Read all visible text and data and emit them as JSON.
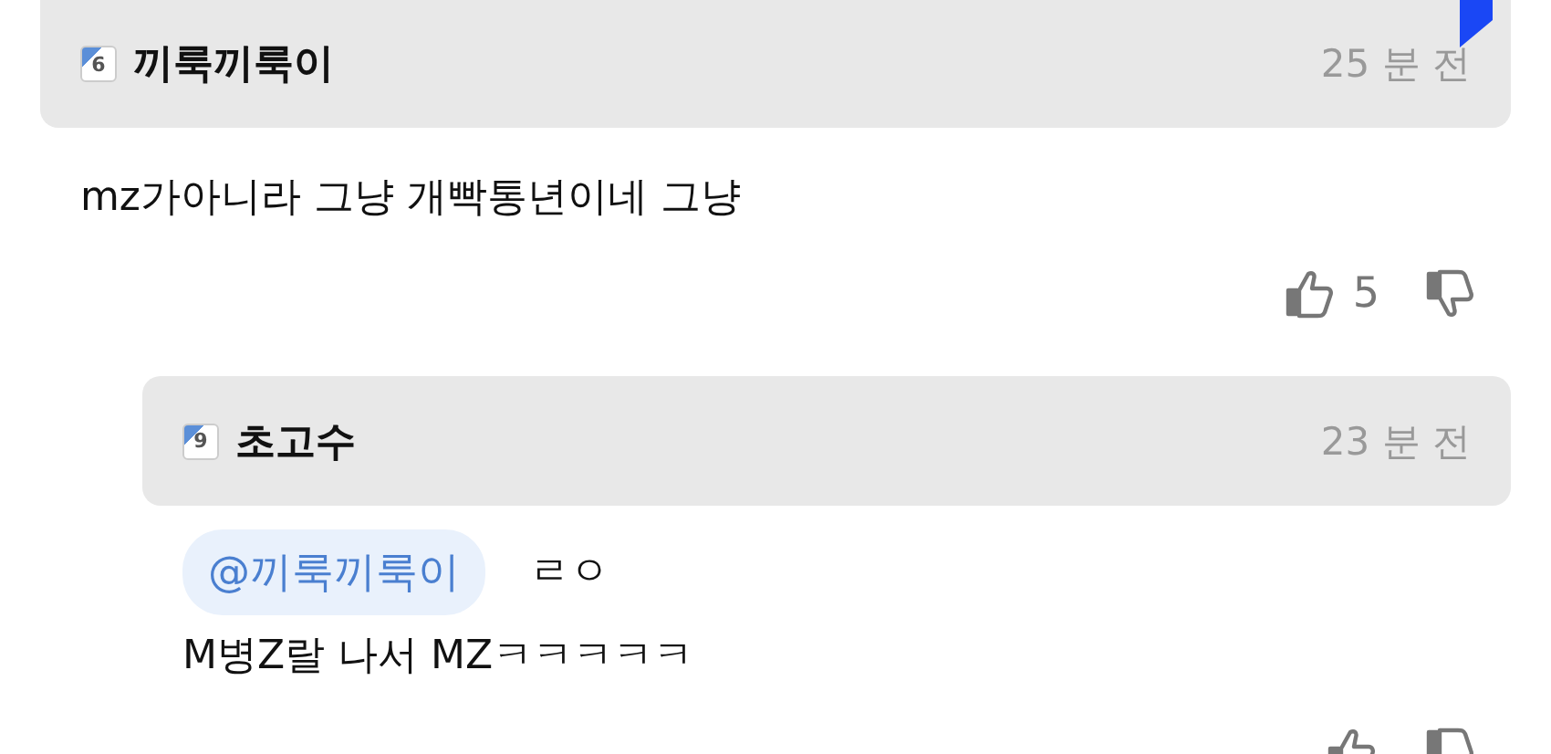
{
  "comments": [
    {
      "author": "끼룩끼룩이",
      "level": "6",
      "time": "25 분 전",
      "text": "mz가아니라 그냥 개빡통년이네 그냥",
      "likes": "5",
      "bookmarked": true,
      "reply": false
    },
    {
      "author": "초고수",
      "level": "9",
      "time": "23 분 전",
      "mention": "@끼룩끼룩이",
      "first_line": "ㄹㅇ",
      "text": "M병Z랄 나서 MZㅋㅋㅋㅋㅋ",
      "bookmarked": false,
      "reply": true
    }
  ]
}
